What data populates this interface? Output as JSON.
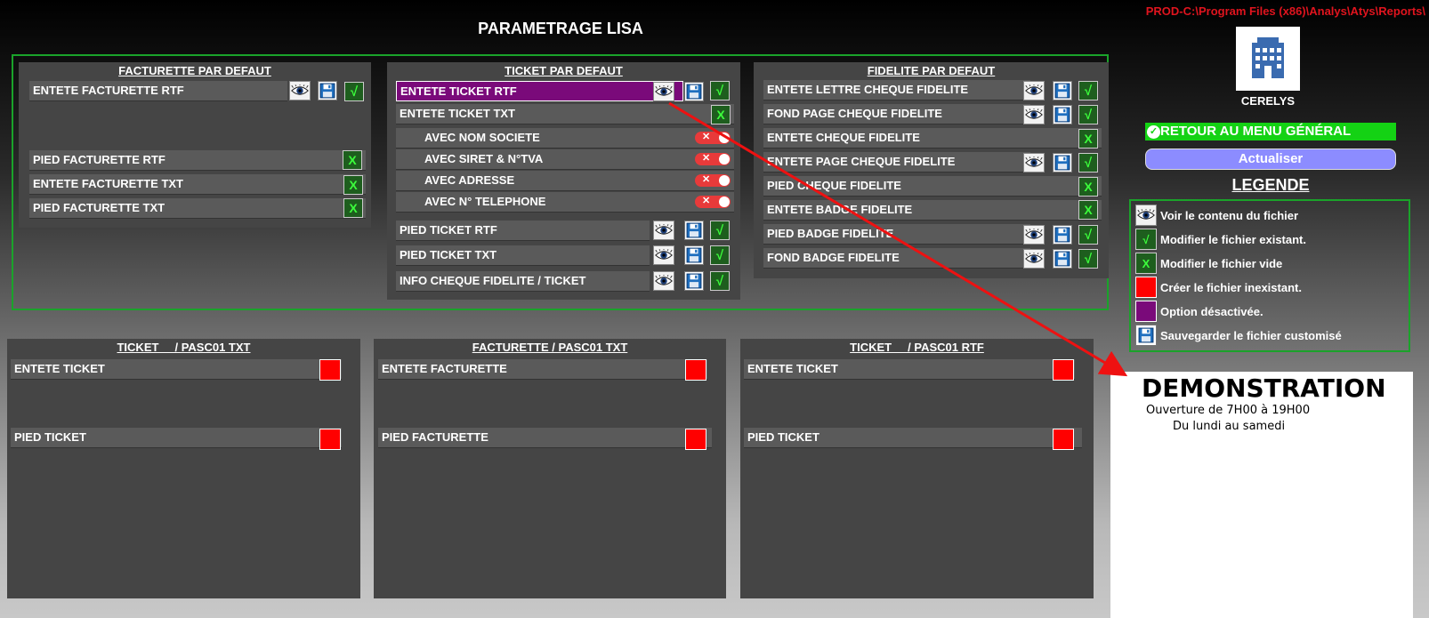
{
  "header": {
    "title": "PARAMETRAGE LISA",
    "path": "PROD-C:\\Program Files (x86)\\Analys\\Atys\\Reports\\"
  },
  "facturette": {
    "title": "FACTURETTE PAR DEFAUT",
    "rows": [
      "ENTETE FACTURETTE RTF",
      "PIED FACTURETTE RTF",
      "ENTETE FACTURETTE TXT",
      "PIED FACTURETTE TXT"
    ]
  },
  "ticket": {
    "title": "TICKET PAR DEFAUT",
    "rows": [
      "ENTETE TICKET RTF",
      "ENTETE TICKET TXT",
      "AVEC NOM SOCIETE",
      "AVEC SIRET & N°TVA",
      "AVEC ADRESSE",
      "AVEC N° TELEPHONE",
      "PIED TICKET RTF",
      "PIED TICKET TXT",
      "INFO CHEQUE FIDELITE / TICKET"
    ]
  },
  "fidelite": {
    "title": "FIDELITE PAR DEFAUT",
    "rows": [
      "ENTETE LETTRE CHEQUE FIDELITE",
      "FOND PAGE CHEQUE FIDELITE",
      "ENTETE CHEQUE FIDELITE",
      "ENTETE PAGE CHEQUE FIDELITE",
      "PIED CHEQUE FIDELITE",
      "ENTETE BADGE FIDELITE",
      "PIED BADGE FIDELITE",
      "FOND BADGE FIDELITE"
    ]
  },
  "bottom_panels": [
    {
      "title": "TICKET     / PASC01 TXT",
      "rows": [
        "ENTETE TICKET",
        "PIED TICKET"
      ]
    },
    {
      "title": "FACTURETTE / PASC01 TXT",
      "rows": [
        "ENTETE FACTURETTE",
        "PIED FACTURETTE"
      ]
    },
    {
      "title": "TICKET     / PASC01 RTF",
      "rows": [
        "ENTETE TICKET",
        "PIED TICKET"
      ]
    }
  ],
  "side": {
    "logo_label": "CERELYS",
    "retour": "RETOUR AU MENU GÉNÉRAL",
    "actualiser": "Actualiser",
    "legende_title": "LEGENDE",
    "legend": [
      "Voir le contenu du fichier",
      "Modifier le fichier existant.",
      "Modifier le fichier vide",
      "Créer le fichier inexistant.",
      "Option désactivée.",
      "Sauvegarder le fichier customisé"
    ]
  },
  "demo": {
    "title": "DEMONSTRATION",
    "line1": "Ouverture de 7H00 à 19H00",
    "line2": "Du lundi au samedi"
  },
  "glyphs": {
    "check": "√",
    "x": "X"
  },
  "colors": {
    "accent_green": "#1aa32a",
    "red": "#ff0000",
    "purple": "#7a0a7a",
    "button_blue": "#8c8cff",
    "path_red": "#e0141e"
  }
}
